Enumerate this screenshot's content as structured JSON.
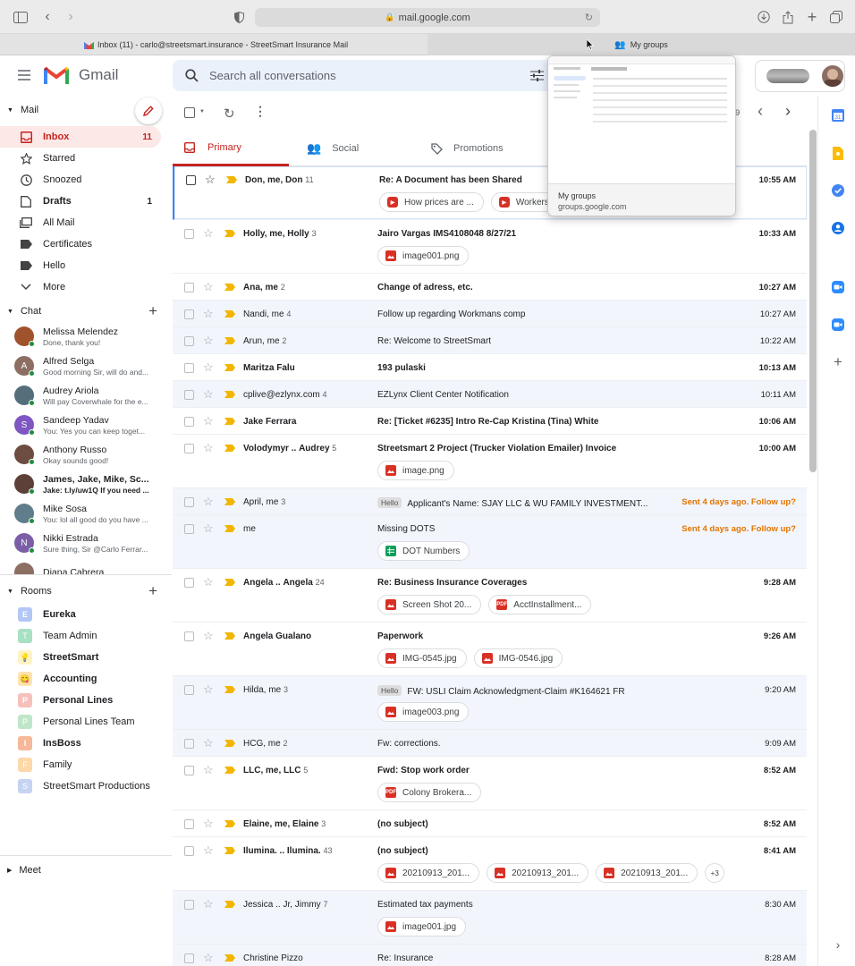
{
  "browser": {
    "url": "mail.google.com",
    "tabs": [
      {
        "title": "Inbox (11) - carlo@streetsmart.insurance - StreetSmart Insurance Mail"
      },
      {
        "title": "My groups"
      }
    ],
    "preview": {
      "title": "My groups",
      "url": "groups.google.com"
    }
  },
  "gmail": {
    "logo_text": "Gmail",
    "search_placeholder": "Search all conversations",
    "page_fragment": "9"
  },
  "sidebar": {
    "mail_header": "Mail",
    "items": [
      {
        "label": "Inbox",
        "count": "11",
        "icon": "inbox-icon"
      },
      {
        "label": "Starred",
        "count": "",
        "icon": "star-icon"
      },
      {
        "label": "Snoozed",
        "count": "",
        "icon": "clock-icon"
      },
      {
        "label": "Drafts",
        "count": "1",
        "icon": "draft-icon"
      },
      {
        "label": "All Mail",
        "count": "",
        "icon": "all-mail-icon"
      },
      {
        "label": "Certificates",
        "count": "",
        "icon": "label-icon"
      },
      {
        "label": "Hello",
        "count": "",
        "icon": "label-icon"
      },
      {
        "label": "More",
        "count": "",
        "icon": "chevron-down-icon"
      }
    ],
    "chat_header": "Chat",
    "chats": [
      {
        "name": "Melissa Melendez",
        "preview": "Done, thank you!",
        "color": "#a0522d",
        "initial": ""
      },
      {
        "name": "Alfred Selga",
        "preview": "Good morning Sir, will do and...",
        "color": "#8d6e63",
        "initial": "A"
      },
      {
        "name": "Audrey Ariola",
        "preview": "Will pay Coverwhale for the e...",
        "color": "#546e7a",
        "initial": ""
      },
      {
        "name": "Sandeep Yadav",
        "preview": "You: Yes you can keep toget...",
        "color": "#7e57c2",
        "initial": "S"
      },
      {
        "name": "Anthony Russo",
        "preview": "Okay sounds good!",
        "color": "#6d4c41",
        "initial": ""
      },
      {
        "name": "James, Jake, Mike, Sc...",
        "preview": "Jake: t.ly/uw1Q If you need ...",
        "color": "#5d4037",
        "initial": ""
      },
      {
        "name": "Mike Sosa",
        "preview": "You: lol all good do you have ...",
        "color": "#607d8b",
        "initial": ""
      },
      {
        "name": "Nikki Estrada",
        "preview": "Sure thing, Sir @Carlo Ferrar...",
        "color": "#7b5ea7",
        "initial": "N"
      },
      {
        "name": "Diana Cabrera",
        "preview": "",
        "color": "#8d6e63",
        "initial": ""
      }
    ],
    "rooms_header": "Rooms",
    "rooms": [
      {
        "name": "Eureka",
        "initial": "E",
        "color": "#b3c7f5",
        "bold": true
      },
      {
        "name": "Team Admin",
        "initial": "T",
        "color": "#a8e0c4",
        "bold": false
      },
      {
        "name": "StreetSmart",
        "initial": "💡",
        "color": "#fff3c4",
        "bold": true
      },
      {
        "name": "Accounting",
        "initial": "😋",
        "color": "#fde3b0",
        "bold": true
      },
      {
        "name": "Personal Lines",
        "initial": "P",
        "color": "#f6c1bd",
        "bold": true
      },
      {
        "name": "Personal Lines Team",
        "initial": "P",
        "color": "#bfe6c9",
        "bold": false
      },
      {
        "name": "InsBoss",
        "initial": "I",
        "color": "#f5b99a",
        "bold": true
      },
      {
        "name": "Family",
        "initial": "F",
        "color": "#fdd8a8",
        "bold": false
      },
      {
        "name": "StreetSmart Productions",
        "initial": "S",
        "color": "#c6d3f2",
        "bold": false
      }
    ],
    "meet_header": "Meet"
  },
  "inbox_tabs": [
    {
      "label": "Primary"
    },
    {
      "label": "Social"
    },
    {
      "label": "Promotions"
    }
  ],
  "emails": [
    {
      "sender_html": "Don, me, <b>Don</b>",
      "count": "11",
      "subject": "Re: A Document has been Shared",
      "label": "",
      "time": "10:55 AM",
      "unread": true,
      "followup": false,
      "chips": [
        {
          "t": "How prices are ...",
          "k": "yt"
        },
        {
          "t": "Workers ...",
          "k": "yt"
        }
      ]
    },
    {
      "sender_html": "Holly, me, <b>Holly</b>",
      "count": "3",
      "subject": "Jairo Vargas IMS4108048 8/27/21",
      "label": "",
      "time": "10:33 AM",
      "unread": true,
      "followup": false,
      "chips": [
        {
          "t": "image001.png",
          "k": "img"
        }
      ]
    },
    {
      "sender_html": "<b>Ana</b>, me",
      "count": "2",
      "subject": "Change of adress, etc.",
      "label": "",
      "time": "10:27 AM",
      "unread": true,
      "followup": false,
      "chips": []
    },
    {
      "sender_html": "Nandi, me",
      "count": "4",
      "subject": "Follow up regarding Workmans comp",
      "label": "",
      "time": "10:27 AM",
      "unread": false,
      "followup": false,
      "chips": []
    },
    {
      "sender_html": "Arun, me",
      "count": "2",
      "subject": "Re: Welcome to StreetSmart",
      "label": "",
      "time": "10:22 AM",
      "unread": false,
      "followup": false,
      "chips": []
    },
    {
      "sender_html": "<b>Maritza Falu</b>",
      "count": "",
      "subject": "193 pulaski",
      "label": "",
      "time": "10:13 AM",
      "unread": true,
      "followup": false,
      "chips": []
    },
    {
      "sender_html": "cplive@ezlynx.com",
      "count": "4",
      "subject": "EZLynx Client Center Notification",
      "label": "",
      "time": "10:11 AM",
      "unread": false,
      "followup": false,
      "chips": []
    },
    {
      "sender_html": "<b>Jake Ferrara</b>",
      "count": "",
      "subject": "Re: [Ticket #6235] Intro Re-Cap Kristina (Tina) White",
      "label": "",
      "time": "10:06 AM",
      "unread": true,
      "followup": false,
      "chips": []
    },
    {
      "sender_html": "Volodymyr .. <b>Audrey</b>",
      "count": "5",
      "subject": "Streetsmart 2 Project (Trucker Violation Emailer) Invoice",
      "label": "",
      "time": "10:00 AM",
      "unread": true,
      "followup": false,
      "chips": [
        {
          "t": "image.png",
          "k": "img"
        }
      ]
    },
    {
      "sender_html": "April, me",
      "count": "3",
      "subject": "Applicant's Name: SJAY LLC & WU FAMILY INVESTMENT...",
      "label": "Hello",
      "time": "Sent 4 days ago. Follow up?",
      "unread": false,
      "followup": true,
      "chips": []
    },
    {
      "sender_html": "me",
      "count": "",
      "subject": "Missing DOTS",
      "label": "",
      "time": "Sent 4 days ago. Follow up?",
      "unread": false,
      "followup": true,
      "chips": [
        {
          "t": "DOT Numbers",
          "k": "sheet"
        }
      ]
    },
    {
      "sender_html": "Angela .. <b>Angela</b>",
      "count": "24",
      "subject": "Re: Business Insurance Coverages",
      "label": "",
      "time": "9:28 AM",
      "unread": true,
      "followup": false,
      "chips": [
        {
          "t": "Screen Shot 20...",
          "k": "img"
        },
        {
          "t": "AcctInstallment...",
          "k": "pdf"
        }
      ]
    },
    {
      "sender_html": "<b>Angela Gualano</b>",
      "count": "",
      "subject": "Paperwork",
      "label": "",
      "time": "9:26 AM",
      "unread": true,
      "followup": false,
      "chips": [
        {
          "t": "IMG-0545.jpg",
          "k": "img"
        },
        {
          "t": "IMG-0546.jpg",
          "k": "img"
        }
      ]
    },
    {
      "sender_html": "Hilda, me",
      "count": "3",
      "subject": "FW: USLI Claim Acknowledgment-Claim #K164621 FR",
      "label": "Hello",
      "time": "9:20 AM",
      "unread": false,
      "followup": false,
      "chips": [
        {
          "t": "image003.png",
          "k": "img"
        }
      ]
    },
    {
      "sender_html": "HCG, me",
      "count": "2",
      "subject": "Fw: corrections.",
      "label": "",
      "time": "9:09 AM",
      "unread": false,
      "followup": false,
      "chips": []
    },
    {
      "sender_html": "LLC, me, <b>LLC</b>",
      "count": "5",
      "subject": "Fwd: Stop work order",
      "label": "",
      "time": "8:52 AM",
      "unread": true,
      "followup": false,
      "chips": [
        {
          "t": "Colony Brokera...",
          "k": "pdf"
        }
      ]
    },
    {
      "sender_html": "Elaine, me, <b>Elaine</b>",
      "count": "3",
      "subject": "(no subject)",
      "label": "",
      "time": "8:52 AM",
      "unread": true,
      "followup": false,
      "chips": []
    },
    {
      "sender_html": "Ilumina. .. <b>Ilumina.</b>",
      "count": "43",
      "subject": "(no subject)",
      "label": "",
      "time": "8:41 AM",
      "unread": true,
      "followup": false,
      "chips": [
        {
          "t": "20210913_201...",
          "k": "img"
        },
        {
          "t": "20210913_201...",
          "k": "img"
        },
        {
          "t": "20210913_201...",
          "k": "img"
        },
        {
          "t": "+3",
          "k": "more"
        }
      ]
    },
    {
      "sender_html": "Jessica .. Jr, Jimmy",
      "count": "7",
      "subject": "Estimated tax payments",
      "label": "",
      "time": "8:30 AM",
      "unread": false,
      "followup": false,
      "chips": [
        {
          "t": "image001.jpg",
          "k": "img"
        }
      ]
    },
    {
      "sender_html": "Christine Pizzo",
      "count": "",
      "subject": "Re: Insurance",
      "label": "",
      "time": "8:28 AM",
      "unread": false,
      "followup": false,
      "chips": []
    }
  ],
  "colors": {
    "accent": "#c5221f",
    "inbox_bg": "#fce8e6",
    "followup": "#e37400",
    "important": "#f2b600"
  }
}
